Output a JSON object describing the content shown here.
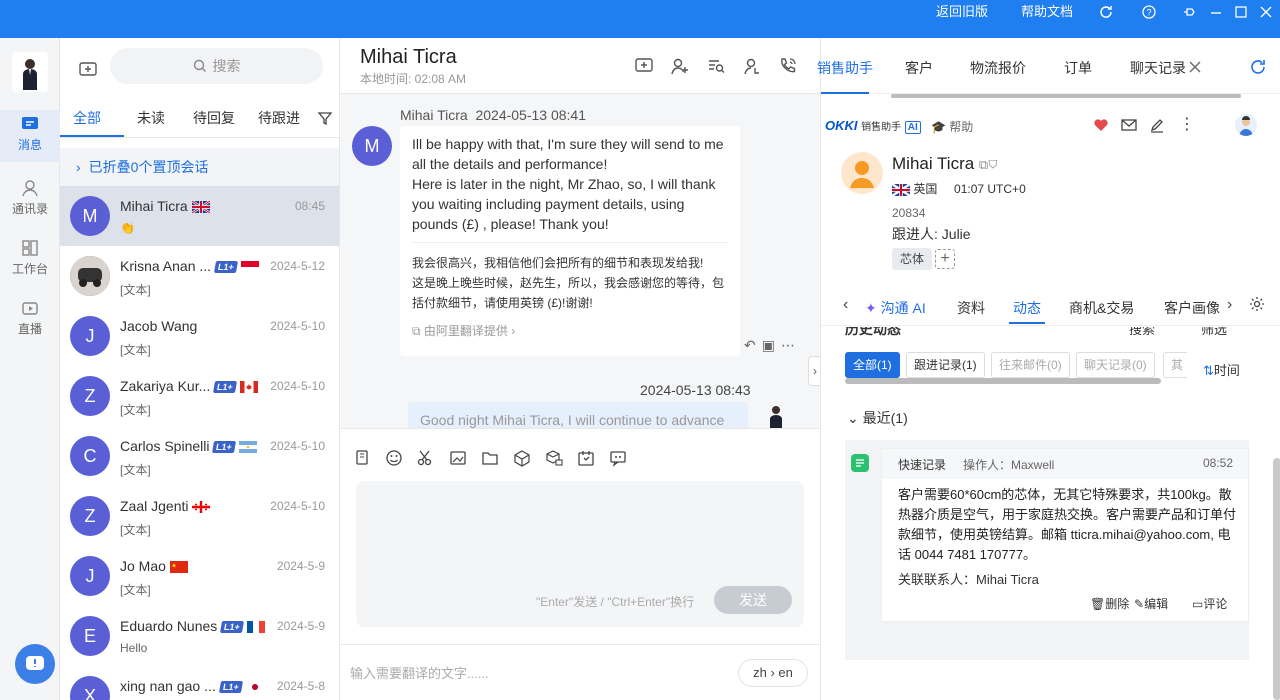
{
  "titlebar": {
    "old_version": "返回旧版",
    "help_doc": "帮助文档"
  },
  "nav": {
    "items": [
      {
        "label": "消息",
        "icon": "message-icon"
      },
      {
        "label": "通讯录",
        "icon": "contacts-icon"
      },
      {
        "label": "工作台",
        "icon": "workbench-icon"
      },
      {
        "label": "直播",
        "icon": "live-icon"
      }
    ]
  },
  "search": {
    "placeholder": "搜索"
  },
  "conv_tabs": [
    "全部",
    "未读",
    "待回复",
    "待跟进"
  ],
  "pinned_label": "已折叠0个置顶会话",
  "conversations": [
    {
      "initial": "M",
      "name": "Mihai Ticra",
      "time": "08:45",
      "msg": "👏",
      "flag": "gb",
      "tag": ""
    },
    {
      "initial": "",
      "name": "Krisna Anan ...",
      "time": "2024-5-12",
      "msg": "[文本]",
      "flag": "id",
      "tag": "L1+"
    },
    {
      "initial": "J",
      "name": "Jacob Wang",
      "time": "2024-5-10",
      "msg": "[文本]",
      "flag": "",
      "tag": ""
    },
    {
      "initial": "Z",
      "name": "Zakariya Kur...",
      "time": "2024-5-10",
      "msg": "[文本]",
      "flag": "ca",
      "tag": "L1+"
    },
    {
      "initial": "C",
      "name": "Carlos Spinelli",
      "time": "2024-5-10",
      "msg": "[文本]",
      "flag": "ar",
      "tag": "L1+"
    },
    {
      "initial": "Z",
      "name": "Zaal Jgenti",
      "time": "2024-5-10",
      "msg": "[文本]",
      "flag": "ge",
      "tag": ""
    },
    {
      "initial": "J",
      "name": "Jo Mao",
      "time": "2024-5-9",
      "msg": "[文本]",
      "flag": "cn",
      "tag": ""
    },
    {
      "initial": "E",
      "name": "Eduardo Nunes",
      "time": "2024-5-9",
      "msg": "Hello",
      "flag": "fr",
      "tag": "L1+"
    },
    {
      "initial": "X",
      "name": "xing nan gao ...",
      "time": "2024-5-8",
      "msg": "",
      "flag": "jp",
      "tag": "L1+"
    }
  ],
  "chat": {
    "contact_name": "Mihai Ticra",
    "local_time": "本地时间: 02:08 AM",
    "msg1_sender": "Mihai Ticra",
    "msg1_time": "2024-05-13 08:41",
    "msg1_text": "Ill be happy with that, I'm sure they will send to me all the details and performance!\nHere is later in the night, Mr Zhao, so, I will thank you waiting including payment details, using pounds (£) , please! Thank you!",
    "msg1_translation": "我会很高兴，我相信他们会把所有的细节和表现发给我!\n这是晚上晚些时候，赵先生，所以，我会感谢您的等待，包括付款细节，请使用英镑 (£)!谢谢!",
    "translation_source": "由阿里翻译提供",
    "msg2_time": "2024-05-13 08:43",
    "msg2_text_partial": "Good night Mihai Ticra, I will continue to advance",
    "composer_hint": "\"Enter\"发送 / \"Ctrl+Enter\"换行",
    "send_label": "发送",
    "translate_placeholder": "输入需要翻译的文字......",
    "lang_from": "zh",
    "lang_to": "en"
  },
  "right": {
    "tabs": [
      "销售助手",
      "客户",
      "物流报价",
      "订单",
      "聊天记录"
    ],
    "brand": "OKKI",
    "brand_sub": "销售助手",
    "brand_ai": "AI",
    "help": "帮助",
    "customer": {
      "name": "Mihai Ticra",
      "country": "英国",
      "time": "01:07 UTC+0",
      "id": "20834",
      "follower": "跟进人: Julie",
      "tag": "芯体"
    },
    "profile_tabs": [
      "沟通 AI",
      "资料",
      "动态",
      "商机&交易",
      "客户画像"
    ],
    "history_title": "历史动态",
    "history_search": "搜索",
    "history_filter": "筛选",
    "filters": [
      "全部(1)",
      "跟进记录(1)",
      "往来邮件(0)",
      "聊天记录(0)",
      "其它"
    ],
    "sort_label": "时间",
    "recent_label": "最近(1)",
    "record": {
      "type": "快速记录",
      "operator": "操作人：Maxwell",
      "time": "08:52",
      "text": "客户需要60*60cm的芯体，无其它特殊要求，共100kg。散热器介质是空气，用于家庭热交换。客户需要产品和订单付款细节，使用英镑结算。邮箱 tticra.mihai@yahoo.com, 电话 0044 7481 170777。",
      "contact": "关联联系人：Mihai Ticra",
      "delete": "删除",
      "edit": "编辑",
      "comment": "评论"
    }
  },
  "colors": {
    "accent": "#1f6fe0",
    "titlebar": "#1f7ef0"
  }
}
